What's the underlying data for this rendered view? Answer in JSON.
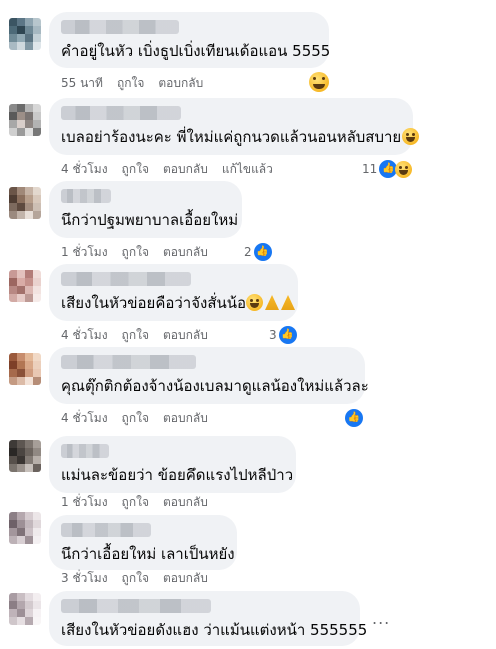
{
  "comments": [
    {
      "text": "คำอยู่ในหัว เบิ่งธูปเบิ่งเทียนเด้อแอน 5555",
      "time": "55 นาที",
      "like": "ถูกใจ",
      "reply": "ตอบกลับ",
      "edited": "",
      "reaction_count": "",
      "reaction_icons": [
        "haha-icon"
      ]
    },
    {
      "text": "เบลอย่าร้องนะคะ พี่ใหม่แค่ถูกนวดแล้วนอนหลับสบาย",
      "time": "4 ชั่วโมง",
      "like": "ถูกใจ",
      "reply": "ตอบกลับ",
      "edited": "แก้ไขแล้ว",
      "reaction_count": "11",
      "reaction_icons": [
        "like-icon",
        "haha-icon"
      ]
    },
    {
      "text": "นึกว่าปฐมพยาบาลเอื้อยใหม่",
      "time": "1 ชั่วโมง",
      "like": "ถูกใจ",
      "reply": "ตอบกลับ",
      "edited": "",
      "reaction_count": "2",
      "reaction_icons": [
        "like-icon"
      ]
    },
    {
      "text": "เสียงในหัวข่อยคือว่าจังสั่นน้อ",
      "time": "4 ชั่วโมง",
      "like": "ถูกใจ",
      "reply": "ตอบกลับ",
      "edited": "",
      "reaction_count": "3",
      "reaction_icons": [
        "like-icon"
      ]
    },
    {
      "text": "คุณตุ๊กติกต้องจ้างน้องเบลมาดูแลน้องใหม่แล้วละ",
      "time": "4 ชั่วโมง",
      "like": "ถูกใจ",
      "reply": "ตอบกลับ",
      "edited": "",
      "reaction_count": "",
      "reaction_icons": [
        "like-icon"
      ]
    },
    {
      "text": "แม่นละข้อยว่า ข้อยคึดแรงไปหลีป่าว",
      "time": "1 ชั่วโมง",
      "like": "ถูกใจ",
      "reply": "ตอบกลับ",
      "edited": "",
      "reaction_count": "",
      "reaction_icons": []
    },
    {
      "text": "นึกว่าเอื้อยใหม่ เลาเป็นหยัง",
      "time": "3 ชั่วโมง",
      "like": "ถูกใจ",
      "reply": "ตอบกลับ",
      "edited": "",
      "reaction_count": "",
      "reaction_icons": []
    },
    {
      "text": "เสียงในหัวข่อยดังแฮง ว่าแม้นแต่งหน้า 555555",
      "time": "",
      "like": "",
      "reply": "",
      "edited": "",
      "reaction_count": "",
      "reaction_icons": []
    }
  ],
  "more_options": "...",
  "colors": {
    "bubble": "#f0f2f5",
    "meta": "#65676b",
    "like_blue": "#1877f2",
    "emoji_yellow": "#f7b928"
  }
}
